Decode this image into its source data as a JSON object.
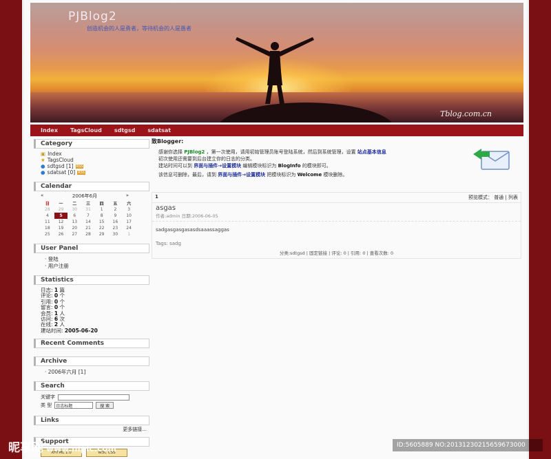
{
  "header": {
    "title": "PJBlog2",
    "subtitle": "创造机会的人是勇者，等待机会的人是愚者",
    "logo_text": "Tblog.com.cn"
  },
  "nav": [
    "Index",
    "TagsCloud",
    "sdtgsd",
    "sdatsat"
  ],
  "sidebar": {
    "category": {
      "title": "Category",
      "items": [
        {
          "label": "Index",
          "badge": ""
        },
        {
          "label": "TagsCloud",
          "badge": ""
        },
        {
          "label": "sdtgsd [1]",
          "badge": "RSS"
        },
        {
          "label": "sdatsat [0]",
          "badge": "RSS"
        }
      ]
    },
    "calendar": {
      "title": "Calendar",
      "prev": "«",
      "month": "2006年6月",
      "next": "»",
      "weekdays": [
        "日",
        "一",
        "二",
        "三",
        "四",
        "五",
        "六"
      ],
      "weeks": [
        [
          "28",
          "29",
          "30",
          "31",
          "1",
          "2",
          "3"
        ],
        [
          "4",
          "5",
          "6",
          "7",
          "8",
          "9",
          "10"
        ],
        [
          "11",
          "12",
          "13",
          "14",
          "15",
          "16",
          "17"
        ],
        [
          "18",
          "19",
          "20",
          "21",
          "22",
          "23",
          "24"
        ],
        [
          "25",
          "26",
          "27",
          "28",
          "29",
          "30",
          "1"
        ]
      ],
      "today": "5"
    },
    "user_panel": {
      "title": "User Panel",
      "items": [
        "登陆",
        "用户注册"
      ]
    },
    "statistics": {
      "title": "Statistics",
      "rows": [
        {
          "label": "日志:",
          "value": "1",
          "unit": "篇"
        },
        {
          "label": "评论:",
          "value": "0",
          "unit": "个"
        },
        {
          "label": "引用:",
          "value": "0",
          "unit": "个"
        },
        {
          "label": "留言:",
          "value": "0",
          "unit": "个"
        },
        {
          "label": "会员:",
          "value": "1",
          "unit": "人"
        },
        {
          "label": "访问:",
          "value": "6",
          "unit": "次"
        },
        {
          "label": "在线:",
          "value": "2",
          "unit": "人"
        },
        {
          "label": "建站时间:",
          "value": "2005-06-20",
          "unit": ""
        }
      ]
    },
    "recent_comments": {
      "title": "Recent Comments"
    },
    "archive": {
      "title": "Archive",
      "items": [
        "2006年六月 [1]"
      ]
    },
    "search": {
      "title": "Search",
      "keyword_label": "关键字",
      "category_label": "类  型",
      "select_value": "日志标题",
      "button": "搜 索"
    },
    "links": {
      "title": "Links",
      "more": "更多链接..."
    },
    "support": {
      "title": "Support",
      "badges": [
        "XHTML 1.0",
        "W3C CSS"
      ]
    }
  },
  "main": {
    "welcome_title": "致Blogger:",
    "welcome_line1_a": "感谢你选择",
    "welcome_line1_b": "PJBlog2",
    "welcome_line1_c": "，第一次使用，请用初始管理员账号登陆系统，然后到系统管理，设置",
    "welcome_line1_d": "站点基本信息",
    "welcome_line2": "初次使用还需要到后台建立你的日志的分类。",
    "welcome_line3_a": "建站时间可以到",
    "welcome_line3_b": "界面与插件→设置模块",
    "welcome_line3_c": "编辑模块标识为",
    "welcome_line3_d": "BlogInfo",
    "welcome_line3_e": "的模块即可。",
    "welcome_line4_a": "该信息可删除，最后，请到",
    "welcome_line4_b": "界面与插件→设置模块",
    "welcome_line4_c": "把模块标识为",
    "welcome_line4_d": "Welcome",
    "welcome_line4_e": "模块删除。",
    "post": {
      "page": "1",
      "mode_label": "预览模式：",
      "mode_normal": "普通",
      "mode_list": "列表",
      "title": "asgas",
      "meta": "作者:admin 日期:2006-06-05",
      "content": "sadgasgasgasasdsaaassaggas",
      "tags": "Tags: sadg",
      "footer": "分类:sdtgsd | 固定链接 | 评论: 0 | 引用: 0 | 查看次数: 0"
    }
  },
  "watermark": {
    "site": "昵享网",
    "url": "www.nipic.com",
    "id_text": "ID:5605889 NO:20131230215659673000"
  }
}
